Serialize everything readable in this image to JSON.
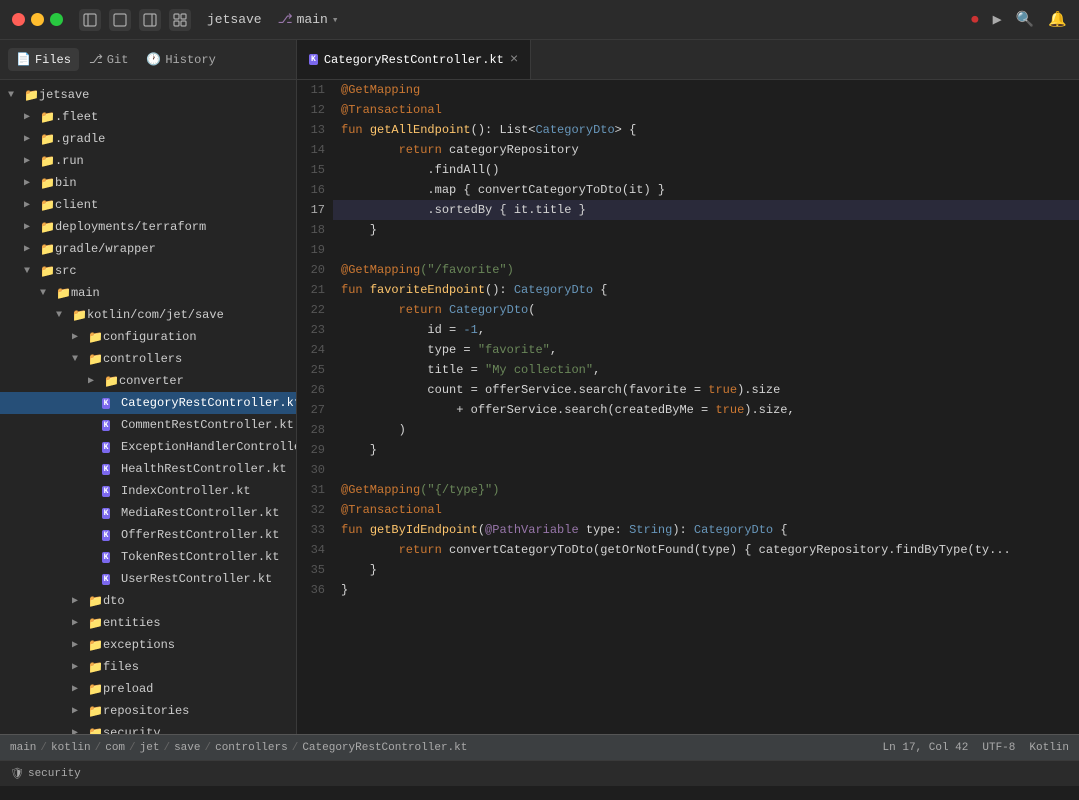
{
  "titlebar": {
    "project": "jetsave",
    "branch": "main",
    "icons": [
      "sidebar-left",
      "square",
      "sidebar-right",
      "grid"
    ],
    "right_icons": [
      "record",
      "play",
      "search",
      "bell"
    ]
  },
  "sidebar": {
    "tabs": [
      {
        "label": "Files",
        "icon": "📄",
        "active": true
      },
      {
        "label": "Git",
        "icon": "⎇"
      },
      {
        "label": "History",
        "icon": "🕐"
      }
    ],
    "tree": [
      {
        "indent": 0,
        "type": "folder",
        "label": "jetsave",
        "expanded": true,
        "arrow": ""
      },
      {
        "indent": 1,
        "type": "folder",
        "label": ".fleet",
        "expanded": false,
        "arrow": "▶"
      },
      {
        "indent": 1,
        "type": "folder",
        "label": ".gradle",
        "expanded": false,
        "arrow": "▶"
      },
      {
        "indent": 1,
        "type": "folder",
        "label": ".run",
        "expanded": false,
        "arrow": "▶"
      },
      {
        "indent": 1,
        "type": "folder",
        "label": "bin",
        "expanded": false,
        "arrow": "▶"
      },
      {
        "indent": 1,
        "type": "folder",
        "label": "client",
        "expanded": false,
        "arrow": "▶"
      },
      {
        "indent": 1,
        "type": "folder",
        "label": "deployments/terraform",
        "expanded": false,
        "arrow": "▶"
      },
      {
        "indent": 1,
        "type": "folder",
        "label": "gradle/wrapper",
        "expanded": false,
        "arrow": "▶"
      },
      {
        "indent": 1,
        "type": "folder",
        "label": "src",
        "expanded": true,
        "arrow": "▼"
      },
      {
        "indent": 2,
        "type": "folder",
        "label": "main",
        "expanded": true,
        "arrow": "▼"
      },
      {
        "indent": 3,
        "type": "folder",
        "label": "kotlin/com/jet/save",
        "expanded": true,
        "arrow": "▼"
      },
      {
        "indent": 4,
        "type": "folder",
        "label": "configuration",
        "expanded": false,
        "arrow": "▶"
      },
      {
        "indent": 4,
        "type": "folder",
        "label": "controllers",
        "expanded": true,
        "arrow": "▼"
      },
      {
        "indent": 5,
        "type": "folder",
        "label": "converter",
        "expanded": false,
        "arrow": "▶"
      },
      {
        "indent": 5,
        "type": "kotlin",
        "label": "CategoryRestController.kt",
        "selected": true
      },
      {
        "indent": 5,
        "type": "kotlin",
        "label": "CommentRestController.kt"
      },
      {
        "indent": 5,
        "type": "kotlin",
        "label": "ExceptionHandlerControlle..."
      },
      {
        "indent": 5,
        "type": "kotlin",
        "label": "HealthRestController.kt"
      },
      {
        "indent": 5,
        "type": "kotlin",
        "label": "IndexController.kt"
      },
      {
        "indent": 5,
        "type": "kotlin",
        "label": "MediaRestController.kt"
      },
      {
        "indent": 5,
        "type": "kotlin",
        "label": "OfferRestController.kt"
      },
      {
        "indent": 5,
        "type": "kotlin",
        "label": "TokenRestController.kt"
      },
      {
        "indent": 5,
        "type": "kotlin",
        "label": "UserRestController.kt"
      },
      {
        "indent": 4,
        "type": "folder",
        "label": "dto",
        "expanded": false,
        "arrow": "▶"
      },
      {
        "indent": 4,
        "type": "folder",
        "label": "entities",
        "expanded": false,
        "arrow": "▶"
      },
      {
        "indent": 4,
        "type": "folder",
        "label": "exceptions",
        "expanded": false,
        "arrow": "▶"
      },
      {
        "indent": 4,
        "type": "folder",
        "label": "files",
        "expanded": false,
        "arrow": "▶"
      },
      {
        "indent": 4,
        "type": "folder",
        "label": "preload",
        "expanded": false,
        "arrow": "▶"
      },
      {
        "indent": 4,
        "type": "folder",
        "label": "repositories",
        "expanded": false,
        "arrow": "▶"
      },
      {
        "indent": 4,
        "type": "folder",
        "label": "security",
        "expanded": false,
        "arrow": "▶"
      }
    ]
  },
  "editor": {
    "tab_label": "CategoryRestController.kt",
    "lines": [
      {
        "num": 11,
        "tokens": [
          {
            "cls": "ann",
            "text": "@GetMapping"
          }
        ]
      },
      {
        "num": 12,
        "tokens": [
          {
            "cls": "ann",
            "text": "@Transactional"
          }
        ]
      },
      {
        "num": 13,
        "tokens": [
          {
            "cls": "kw",
            "text": "fun "
          },
          {
            "cls": "fn",
            "text": "getAllEndpoint"
          },
          {
            "cls": "plain",
            "text": "(): List<"
          },
          {
            "cls": "type",
            "text": "CategoryDto"
          },
          {
            "cls": "plain",
            "text": "> {"
          }
        ]
      },
      {
        "num": 14,
        "tokens": [
          {
            "cls": "plain",
            "text": "        "
          },
          {
            "cls": "kw",
            "text": "return "
          },
          {
            "cls": "plain",
            "text": "categoryRepository"
          }
        ]
      },
      {
        "num": 15,
        "tokens": [
          {
            "cls": "plain",
            "text": "            .findAll()"
          }
        ]
      },
      {
        "num": 16,
        "tokens": [
          {
            "cls": "plain",
            "text": "            .map { convertCategoryToDto(it) }"
          }
        ]
      },
      {
        "num": 17,
        "tokens": [
          {
            "cls": "plain",
            "text": "            .sortedBy { it.title }"
          }
        ],
        "highlighted": true
      },
      {
        "num": 18,
        "tokens": [
          {
            "cls": "plain",
            "text": "    }"
          }
        ]
      },
      {
        "num": 19,
        "tokens": []
      },
      {
        "num": 20,
        "tokens": [
          {
            "cls": "ann",
            "text": "@GetMapping"
          },
          {
            "cls": "str",
            "text": "(\"/favorite\")"
          }
        ]
      },
      {
        "num": 21,
        "tokens": [
          {
            "cls": "kw",
            "text": "fun "
          },
          {
            "cls": "fn",
            "text": "favoriteEndpoint"
          },
          {
            "cls": "plain",
            "text": "(): "
          },
          {
            "cls": "type",
            "text": "CategoryDto"
          },
          {
            "cls": "plain",
            "text": " {"
          }
        ]
      },
      {
        "num": 22,
        "tokens": [
          {
            "cls": "plain",
            "text": "        "
          },
          {
            "cls": "kw",
            "text": "return "
          },
          {
            "cls": "type",
            "text": "CategoryDto"
          },
          {
            "cls": "plain",
            "text": "("
          }
        ]
      },
      {
        "num": 23,
        "tokens": [
          {
            "cls": "plain",
            "text": "            id = "
          },
          {
            "cls": "num",
            "text": "-1"
          },
          {
            "cls": "plain",
            "text": ","
          }
        ]
      },
      {
        "num": 24,
        "tokens": [
          {
            "cls": "plain",
            "text": "            type = "
          },
          {
            "cls": "str",
            "text": "\"favorite\""
          },
          {
            "cls": "plain",
            "text": ","
          }
        ]
      },
      {
        "num": 25,
        "tokens": [
          {
            "cls": "plain",
            "text": "            title = "
          },
          {
            "cls": "str",
            "text": "\"My collection\""
          },
          {
            "cls": "plain",
            "text": ","
          }
        ]
      },
      {
        "num": 26,
        "tokens": [
          {
            "cls": "plain",
            "text": "            count = offerService.search(favorite = "
          },
          {
            "cls": "bool",
            "text": "true"
          },
          {
            "cls": "plain",
            "text": ").size"
          }
        ]
      },
      {
        "num": 27,
        "tokens": [
          {
            "cls": "plain",
            "text": "                + offerService.search(createdByMe = "
          },
          {
            "cls": "bool",
            "text": "true"
          },
          {
            "cls": "plain",
            "text": ").size,"
          }
        ]
      },
      {
        "num": 28,
        "tokens": [
          {
            "cls": "plain",
            "text": "        )"
          }
        ]
      },
      {
        "num": 29,
        "tokens": [
          {
            "cls": "plain",
            "text": "    }"
          }
        ]
      },
      {
        "num": 30,
        "tokens": []
      },
      {
        "num": 31,
        "tokens": [
          {
            "cls": "ann",
            "text": "@GetMapping"
          },
          {
            "cls": "str",
            "text": "(\"{/type}\")"
          }
        ]
      },
      {
        "num": 32,
        "tokens": [
          {
            "cls": "ann",
            "text": "@Transactional"
          }
        ]
      },
      {
        "num": 33,
        "tokens": [
          {
            "cls": "kw",
            "text": "fun "
          },
          {
            "cls": "fn",
            "text": "getByIdEndpoint"
          },
          {
            "cls": "plain",
            "text": "("
          },
          {
            "cls": "param",
            "text": "@PathVariable"
          },
          {
            "cls": "plain",
            "text": " type: "
          },
          {
            "cls": "type",
            "text": "String"
          },
          {
            "cls": "plain",
            "text": "): "
          },
          {
            "cls": "type",
            "text": "CategoryDto"
          },
          {
            "cls": "plain",
            "text": " {"
          }
        ]
      },
      {
        "num": 34,
        "tokens": [
          {
            "cls": "plain",
            "text": "        "
          },
          {
            "cls": "kw",
            "text": "return "
          },
          {
            "cls": "plain",
            "text": "convertCategoryToDto(getOrNotFound(type) { categoryRepository.findByType(ty..."
          }
        ]
      },
      {
        "num": 35,
        "tokens": [
          {
            "cls": "plain",
            "text": "    }"
          }
        ]
      },
      {
        "num": 36,
        "tokens": [
          {
            "cls": "plain",
            "text": "}"
          }
        ]
      }
    ]
  },
  "statusbar": {
    "breadcrumb": [
      "main",
      "kotlin",
      "com",
      "jet",
      "save",
      "controllers",
      "CategoryRestController.kt"
    ],
    "position": "Ln 17, Col 42",
    "encoding": "UTF-8",
    "language": "Kotlin"
  },
  "bottombar": {
    "security_label": "security"
  }
}
